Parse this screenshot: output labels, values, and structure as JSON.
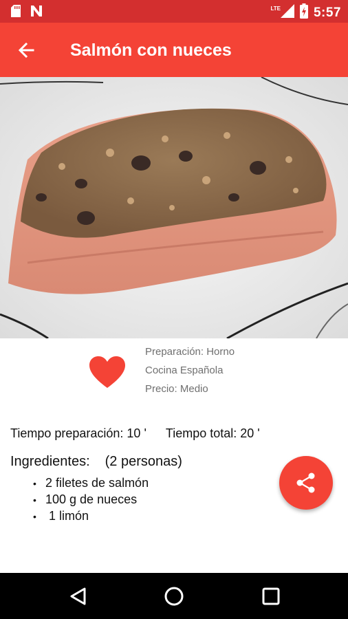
{
  "status_bar": {
    "network_label": "LTE",
    "time": "5:57",
    "icons": [
      "sd-card-icon",
      "notification-n-icon",
      "signal-icon",
      "battery-charging-icon"
    ]
  },
  "app_bar": {
    "title": "Salmón con nueces",
    "back_icon": "arrow-back-icon"
  },
  "recipe": {
    "image_icon": "recipe-photo",
    "favorite_icon": "heart-icon",
    "preparation": "Preparación: Horno",
    "cuisine": "Cocina Española",
    "price": "Precio: Medio",
    "prep_time": "Tiempo preparación: 10 '",
    "total_time": "Tiempo total: 20 '",
    "ingredients_title": "Ingredientes:",
    "servings": "(2 personas)",
    "ingredients": [
      {
        "bullet": "•",
        "text": "2 filetes de salmón"
      },
      {
        "bullet": "•",
        "text": "100 g de nueces"
      },
      {
        "bullet": "•",
        "text": " 1 limón"
      }
    ]
  },
  "fab": {
    "icon": "share-icon"
  },
  "nav_bar": {
    "icons": [
      "back-triangle-icon",
      "home-circle-icon",
      "recents-square-icon"
    ]
  },
  "colors": {
    "status_bar": "#d32f2f",
    "app_bar": "#f44336",
    "accent": "#f44336",
    "secondary_text": "#6f6f6f",
    "nav_bar": "#000000"
  }
}
